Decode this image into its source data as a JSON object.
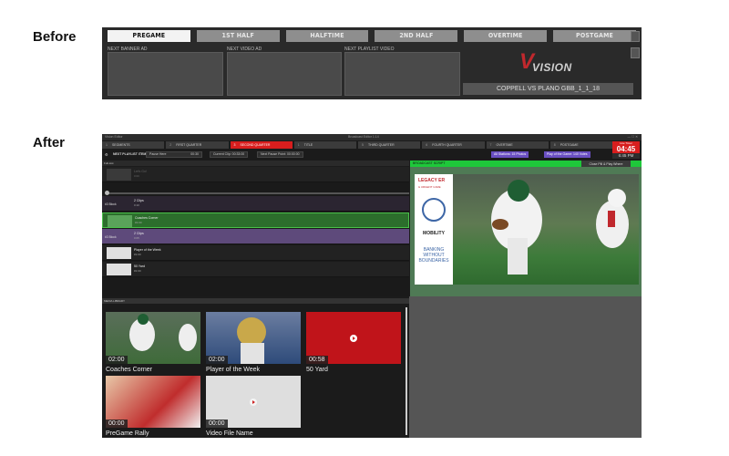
{
  "labels": {
    "before": "Before",
    "after": "After"
  },
  "before": {
    "phases": [
      "PREGAME",
      "1ST HALF",
      "HALFTIME",
      "2ND HALF",
      "OVERTIME",
      "POSTGAME"
    ],
    "active_phase": "PREGAME",
    "slot_labels": [
      "NEXT BANNER AD",
      "NEXT VIDEO AD",
      "NEXT PLAYLIST VIDEO"
    ],
    "logo_text": "VISION",
    "game_title": "COPPELL VS PLANO GBB_1_1_18"
  },
  "after": {
    "titlebar": {
      "left": "Vision Editor",
      "center": "Broadcast Editor 1.14",
      "right": "— ☐ ✕"
    },
    "segments": [
      {
        "num": "1",
        "label": "SEGMENTS",
        "red": false
      },
      {
        "num": "2",
        "label": "FIRST QUARTER",
        "red": false
      },
      {
        "num": "3",
        "label": "SECOND QUARTER",
        "red": true
      },
      {
        "num": "1",
        "label": "TITLE",
        "red": false
      },
      {
        "num": "5",
        "label": "THIRD QUARTER",
        "red": false
      },
      {
        "num": "6",
        "label": "FOURTH QUARTER",
        "red": false
      },
      {
        "num": "7",
        "label": "OVERTIME",
        "red": false
      },
      {
        "num": "8",
        "label": "POSTGAME",
        "red": false
      }
    ],
    "timer": {
      "label": "Live Timer",
      "value": "04:45"
    },
    "clock": "6:45 PM",
    "info": {
      "next_item_label": "NEXT PLAYLIST ITEM",
      "pause_label": "Pause Here",
      "pause_time": "00:30",
      "current_clip": "Current Clip: 00:33:00",
      "next_pause": "Next Pause Point: 00:00:00",
      "all_stations": "All Stations: 15 Photos",
      "play_of_game": "Play of the Game: 140 Votes"
    },
    "filter_label": "Full-List",
    "broadcast_label": "BROADCAST SCRIPT",
    "close_button": "Close Pill & Play Where",
    "playlist": [
      {
        "title": "Let's Go!",
        "sub": "0:00",
        "tag": "",
        "style": "dim"
      },
      {
        "title": "2 Clips",
        "sub": "0:10",
        "tag": "#3 Block",
        "style": "darkpurple"
      },
      {
        "title": "Coaches Corner",
        "sub": "#1:00",
        "tag": "",
        "style": "green"
      },
      {
        "title": "2 Clips",
        "sub": "0:05",
        "tag": "#3 Block",
        "style": "purple"
      },
      {
        "title": "Player of the Week",
        "sub": "#1:00",
        "tag": "",
        "style": "normal"
      },
      {
        "title": "50 Yard",
        "sub": "#1:00",
        "tag": "",
        "style": "normal"
      }
    ],
    "sponsor": {
      "logo": "LEGACY ER",
      "sub": "& URGENT CARE",
      "brand": "MOBILITY",
      "tagline": "BANKING WITHOUT BOUNDARIES"
    },
    "library_label": "MEDIA LIBRARY",
    "library": [
      {
        "title": "Coaches Corner",
        "duration": "02:00",
        "kind": "football"
      },
      {
        "title": "Player of the Week",
        "duration": "02:00",
        "kind": "helmet"
      },
      {
        "title": "50 Yard",
        "duration": "00:58",
        "kind": "red"
      },
      {
        "title": "PreGame Rally",
        "duration": "00:00",
        "kind": "crowd"
      },
      {
        "title": "Video File Name",
        "duration": "00:00",
        "kind": "blank"
      }
    ],
    "colors": {
      "accent_red": "#d81e1e",
      "accent_green": "#1ec83a",
      "purple": "#6a4fc2"
    }
  }
}
